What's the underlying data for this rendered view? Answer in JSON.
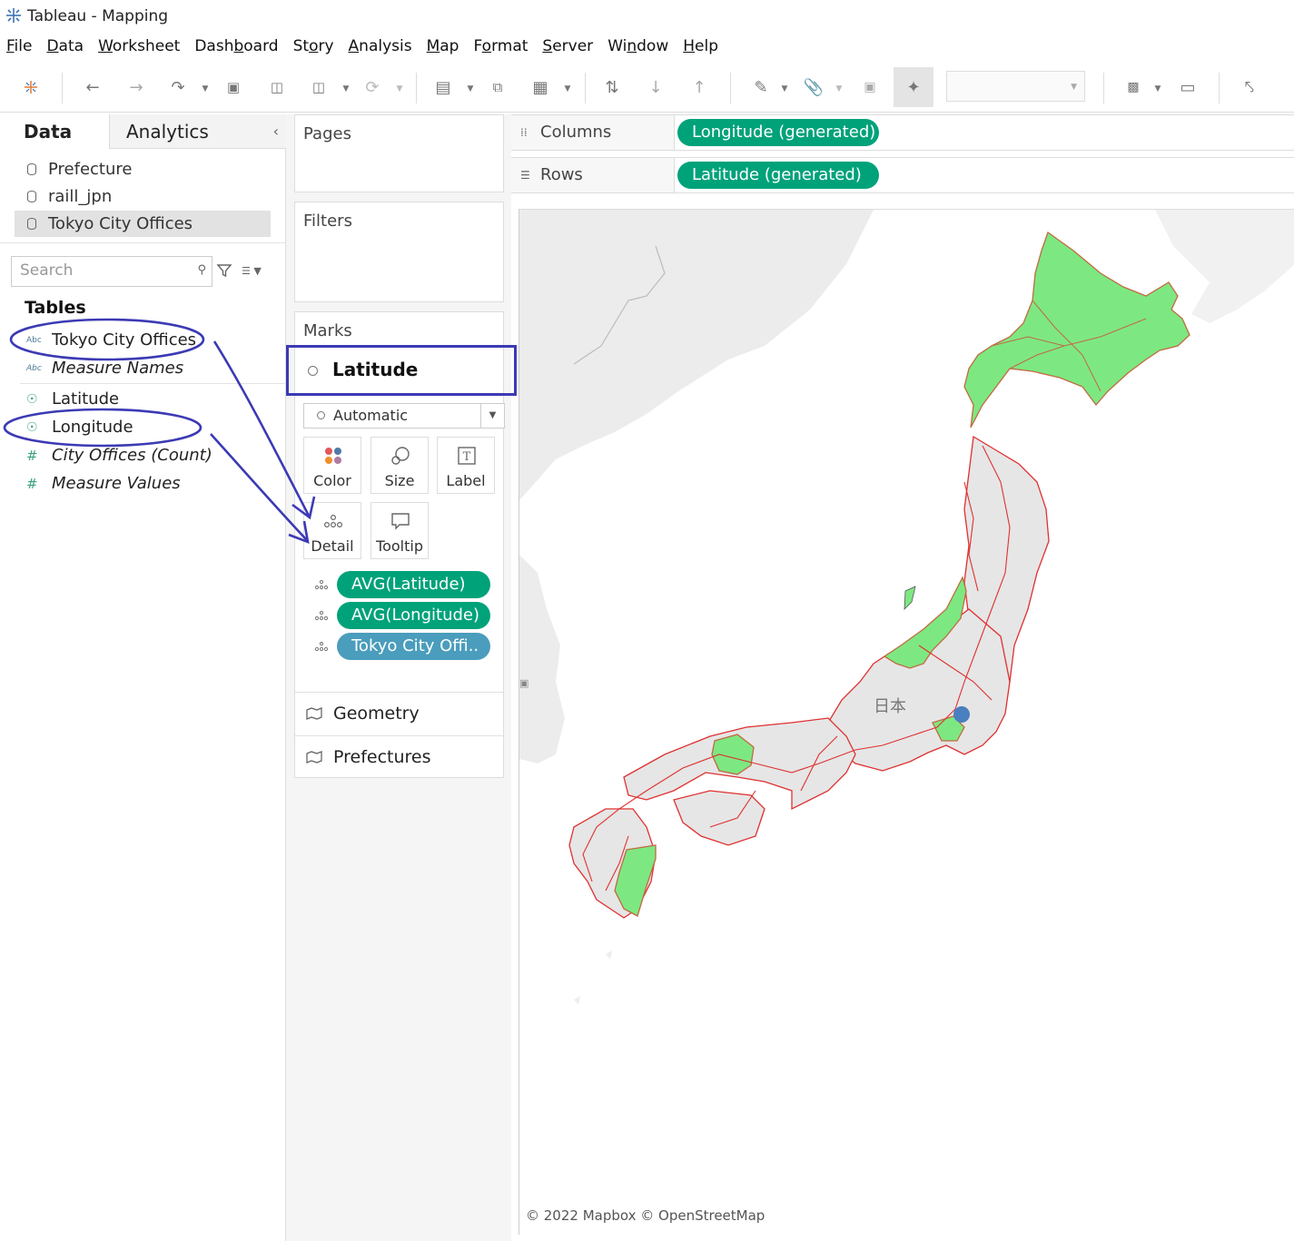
{
  "window": {
    "title": "Tableau - Mapping"
  },
  "menu": [
    {
      "pre": "",
      "u": "F",
      "post": "ile"
    },
    {
      "pre": "",
      "u": "D",
      "post": "ata"
    },
    {
      "pre": "",
      "u": "W",
      "post": "orksheet"
    },
    {
      "pre": "Dash",
      "u": "b",
      "post": "oard"
    },
    {
      "pre": "St",
      "u": "o",
      "post": "ry"
    },
    {
      "pre": "",
      "u": "A",
      "post": "nalysis"
    },
    {
      "pre": "",
      "u": "M",
      "post": "ap"
    },
    {
      "pre": "F",
      "u": "o",
      "post": "rmat"
    },
    {
      "pre": "",
      "u": "S",
      "post": "erver"
    },
    {
      "pre": "Wi",
      "u": "n",
      "post": "dow"
    },
    {
      "pre": "",
      "u": "H",
      "post": "elp"
    }
  ],
  "toolbar": {
    "icons": [
      "tableau-logo-icon",
      "undo-icon",
      "redo-icon",
      "replay-icon",
      "save-icon",
      "new-datasource-icon",
      "pause-updates-icon",
      "refresh-icon",
      "new-worksheet-icon",
      "duplicate-sheet-icon",
      "clear-sheet-icon",
      "swap-icon",
      "sort-ascending-icon",
      "sort-descending-icon",
      "highlight-icon",
      "group-icon",
      "show-labels-icon",
      "fix-axes-icon",
      "show-me-icon",
      "presentation-icon",
      "share-icon"
    ],
    "fit_combo_value": ""
  },
  "data_pane": {
    "tabs": {
      "data": "Data",
      "analytics": "Analytics",
      "collapse": "‹"
    },
    "datasources": [
      {
        "label": "Prefecture",
        "selected": false
      },
      {
        "label": "raill_jpn",
        "selected": false
      },
      {
        "label": "Tokyo City Offices",
        "selected": true
      }
    ],
    "search": {
      "value": "",
      "placeholder": "Search"
    },
    "tables_heading": "Tables",
    "dimensions": [
      {
        "type": "Abc",
        "label": "Tokyo City Offices",
        "italic": false
      },
      {
        "type": "Abc",
        "label": "Measure Names",
        "italic": true
      }
    ],
    "measures": [
      {
        "type": "geo",
        "label": "Latitude",
        "italic": false
      },
      {
        "type": "geo",
        "label": "Longitude",
        "italic": false
      },
      {
        "type": "#",
        "label": "City Offices (Count)",
        "italic": true
      },
      {
        "type": "#",
        "label": "Measure Values",
        "italic": true
      }
    ]
  },
  "shelves": {
    "pages": "Pages",
    "filters": "Filters",
    "marks": {
      "title": "Marks",
      "layer": "Latitude",
      "mark_type": "Automatic",
      "buttons": {
        "color": "Color",
        "size": "Size",
        "label": "Label",
        "detail": "Detail",
        "tooltip": "Tooltip"
      },
      "pills": [
        {
          "label": "AVG(Latitude)",
          "color": "#00a27a"
        },
        {
          "label": "AVG(Longitude)",
          "color": "#00a27a"
        },
        {
          "label": "Tokyo City Offi..",
          "color": "#4a9dbc"
        }
      ],
      "layers": [
        "Geometry",
        "Prefectures"
      ]
    }
  },
  "columns": {
    "label": "Columns",
    "pill": "Longitude (generated)"
  },
  "rows": {
    "label": "Rows",
    "pill": "Latitude (generated)"
  },
  "map": {
    "country_label": "日本",
    "credit": "© 2022 Mapbox © OpenStreetMap",
    "colors": {
      "highlight_fill": "#7de882",
      "rail": "#e03030",
      "land": "#e6e6e6",
      "point": "#4a7fc0"
    }
  },
  "colors": {
    "accent_pill": "#00a27a",
    "dimension_pill": "#4a9dbc",
    "annotation": "#3c3ab4"
  }
}
